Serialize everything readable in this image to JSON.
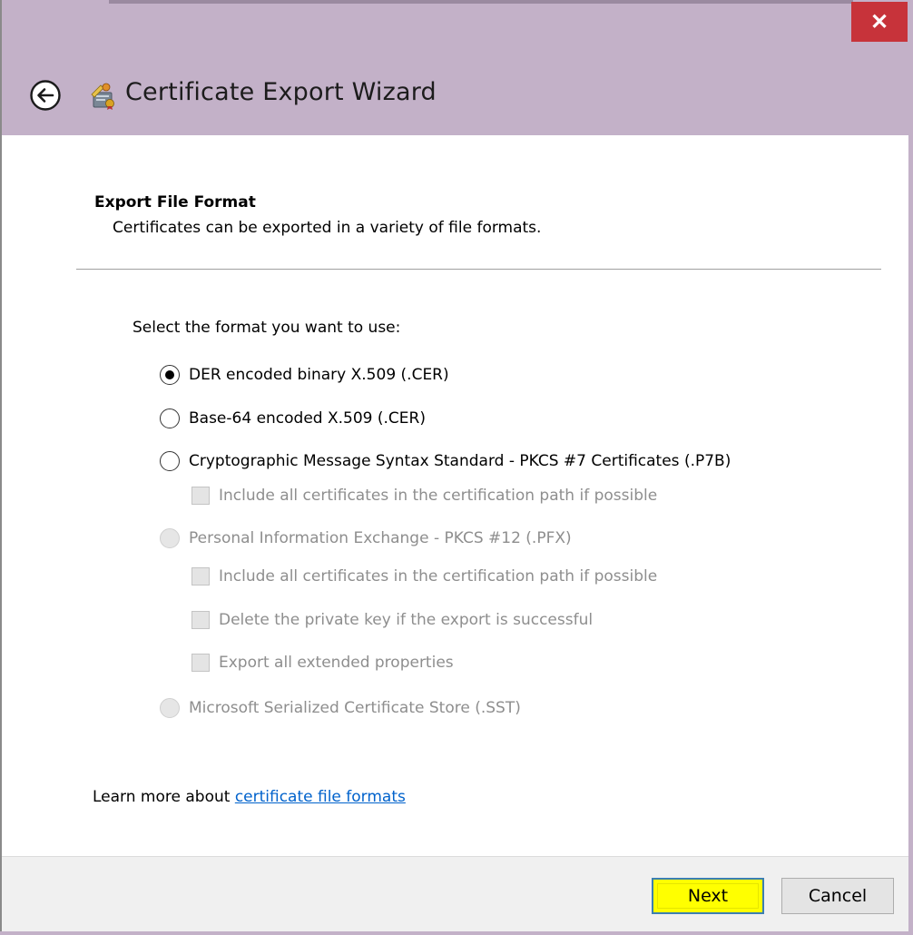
{
  "window": {
    "close_glyph": "✕",
    "title": "Certificate Export Wizard",
    "accent_color": "#c3b1c8",
    "close_color": "#c7333a"
  },
  "header": {
    "back_icon": "back-arrow-icon",
    "wizard_icon": "certificate-icon"
  },
  "page": {
    "section_title": "Export File Format",
    "section_description": "Certificates can be exported in a variety of file formats.",
    "prompt": "Select the format you want to use:",
    "options": [
      {
        "label": "DER encoded binary X.509 (.CER)",
        "selected": true,
        "enabled": true
      },
      {
        "label": "Base-64 encoded X.509 (.CER)",
        "selected": false,
        "enabled": true
      },
      {
        "label": "Cryptographic Message Syntax Standard - PKCS #7 Certificates (.P7B)",
        "selected": false,
        "enabled": true
      },
      {
        "label": "Personal Information Exchange - PKCS #12 (.PFX)",
        "selected": false,
        "enabled": false
      },
      {
        "label": "Microsoft Serialized Certificate Store (.SST)",
        "selected": false,
        "enabled": false
      }
    ],
    "p7b_checkbox": {
      "label": "Include all certificates in the certification path if possible",
      "checked": false,
      "enabled": false
    },
    "pfx_checkboxes": [
      {
        "label": "Include all certificates in the certification path if possible",
        "checked": false,
        "enabled": false
      },
      {
        "label": "Delete the private key if the export is successful",
        "checked": false,
        "enabled": false
      },
      {
        "label": "Export all extended properties",
        "checked": false,
        "enabled": false
      }
    ],
    "learn_more_prefix": "Learn more about ",
    "learn_more_link": "certificate file formats"
  },
  "footer": {
    "next_label": "Next",
    "cancel_label": "Cancel",
    "next_highlight_color": "#ffff00"
  }
}
